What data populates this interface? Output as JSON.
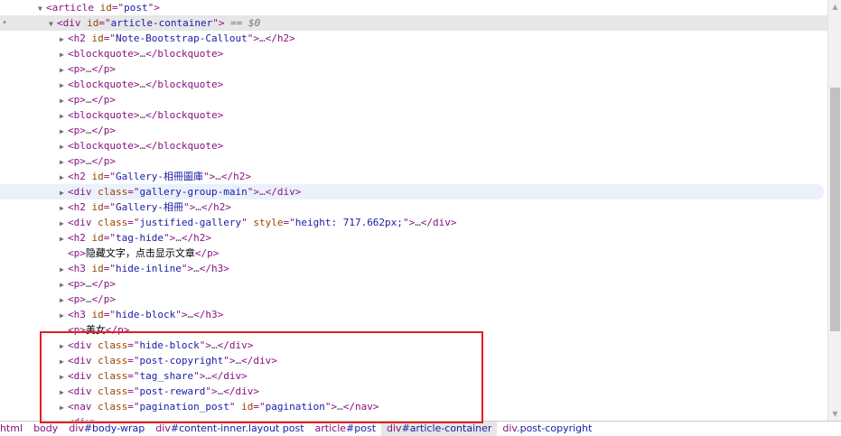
{
  "colors": {
    "tag": "#881280",
    "attr_name": "#994500",
    "attr_value": "#1a1aa6",
    "highlight": "#e02020"
  },
  "selected_suffix": "== $0",
  "rows": [
    {
      "indent": 1,
      "toggle": "expanded",
      "tag": "article",
      "attrs": [
        {
          "n": "id",
          "v": "post"
        }
      ],
      "tail": ""
    },
    {
      "indent": 2,
      "toggle": "expanded",
      "tag": "div",
      "attrs": [
        {
          "n": "id",
          "v": "article-container"
        }
      ],
      "tail": "",
      "selected": true
    },
    {
      "indent": 3,
      "toggle": "collapsed",
      "tag": "h2",
      "attrs": [
        {
          "n": "id",
          "v": "Note-Bootstrap-Callout"
        }
      ],
      "tail": "…</h2>"
    },
    {
      "indent": 3,
      "toggle": "collapsed",
      "tag": "blockquote",
      "attrs": [],
      "tail": "…</blockquote>"
    },
    {
      "indent": 3,
      "toggle": "collapsed",
      "tag": "p",
      "attrs": [],
      "tail": "…</p>"
    },
    {
      "indent": 3,
      "toggle": "collapsed",
      "tag": "blockquote",
      "attrs": [],
      "tail": "…</blockquote>"
    },
    {
      "indent": 3,
      "toggle": "collapsed",
      "tag": "p",
      "attrs": [],
      "tail": "…</p>"
    },
    {
      "indent": 3,
      "toggle": "collapsed",
      "tag": "blockquote",
      "attrs": [],
      "tail": "…</blockquote>"
    },
    {
      "indent": 3,
      "toggle": "collapsed",
      "tag": "p",
      "attrs": [],
      "tail": "…</p>"
    },
    {
      "indent": 3,
      "toggle": "collapsed",
      "tag": "blockquote",
      "attrs": [],
      "tail": "…</blockquote>"
    },
    {
      "indent": 3,
      "toggle": "collapsed",
      "tag": "p",
      "attrs": [],
      "tail": "…</p>"
    },
    {
      "indent": 3,
      "toggle": "collapsed",
      "tag": "h2",
      "attrs": [
        {
          "n": "id",
          "v": "Gallery-相冊圖庫"
        }
      ],
      "tail": "…</h2>"
    },
    {
      "indent": 3,
      "toggle": "collapsed",
      "tag": "div",
      "attrs": [
        {
          "n": "class",
          "v": "gallery-group-main"
        }
      ],
      "tail": "…</div>",
      "hovered": true
    },
    {
      "indent": 3,
      "toggle": "collapsed",
      "tag": "h2",
      "attrs": [
        {
          "n": "id",
          "v": "Gallery-相冊"
        }
      ],
      "tail": "…</h2>"
    },
    {
      "indent": 3,
      "toggle": "collapsed",
      "tag": "div",
      "attrs": [
        {
          "n": "class",
          "v": "justified-gallery"
        },
        {
          "n": "style",
          "v": "height: 717.662px;"
        }
      ],
      "tail": "…</div>"
    },
    {
      "indent": 3,
      "toggle": "collapsed",
      "tag": "h2",
      "attrs": [
        {
          "n": "id",
          "v": "tag-hide"
        }
      ],
      "tail": "…</h2>"
    },
    {
      "indent": 3,
      "toggle": "none",
      "tag": "p",
      "attrs": [],
      "text": "隐藏文字，点击显示文章",
      "tail": "</p>"
    },
    {
      "indent": 3,
      "toggle": "collapsed",
      "tag": "h3",
      "attrs": [
        {
          "n": "id",
          "v": "hide-inline"
        }
      ],
      "tail": "…</h3>"
    },
    {
      "indent": 3,
      "toggle": "collapsed",
      "tag": "p",
      "attrs": [],
      "tail": "…</p>"
    },
    {
      "indent": 3,
      "toggle": "collapsed",
      "tag": "p",
      "attrs": [],
      "tail": "…</p>"
    },
    {
      "indent": 3,
      "toggle": "collapsed",
      "tag": "h3",
      "attrs": [
        {
          "n": "id",
          "v": "hide-block"
        }
      ],
      "tail": "…</h3>"
    },
    {
      "indent": 3,
      "toggle": "none",
      "tag": "p",
      "attrs": [],
      "text": "美女",
      "tail": "</p>"
    },
    {
      "indent": 3,
      "toggle": "collapsed",
      "tag": "div",
      "attrs": [
        {
          "n": "class",
          "v": "hide-block"
        }
      ],
      "tail": "…</div>"
    },
    {
      "indent": 3,
      "toggle": "collapsed",
      "tag": "div",
      "attrs": [
        {
          "n": "class",
          "v": "post-copyright"
        }
      ],
      "tail": "…</div>"
    },
    {
      "indent": 3,
      "toggle": "collapsed",
      "tag": "div",
      "attrs": [
        {
          "n": "class",
          "v": "tag_share"
        }
      ],
      "tail": "…</div>"
    },
    {
      "indent": 3,
      "toggle": "collapsed",
      "tag": "div",
      "attrs": [
        {
          "n": "class",
          "v": "post-reward"
        }
      ],
      "tail": "…</div>"
    },
    {
      "indent": 3,
      "toggle": "collapsed",
      "tag": "nav",
      "attrs": [
        {
          "n": "class",
          "v": "pagination_post"
        },
        {
          "n": "id",
          "v": "pagination"
        }
      ],
      "tail": "…</nav>"
    },
    {
      "indent": 3,
      "toggle": "collapsed",
      "tag": "div",
      "attrs": [],
      "tail": ""
    }
  ],
  "breadcrumb": [
    {
      "tag": "html",
      "sel": ""
    },
    {
      "tag": "body",
      "sel": ""
    },
    {
      "tag": "div",
      "sel": "#body-wrap"
    },
    {
      "tag": "div",
      "sel": "#content-inner.layout post"
    },
    {
      "tag": "article",
      "sel": "#post"
    },
    {
      "tag": "div",
      "sel": "#article-container",
      "active": true
    },
    {
      "tag": "div",
      "sel": ".post-copyright"
    }
  ],
  "scrollbar": {
    "up_icon": "▲",
    "down_icon": "▼"
  }
}
